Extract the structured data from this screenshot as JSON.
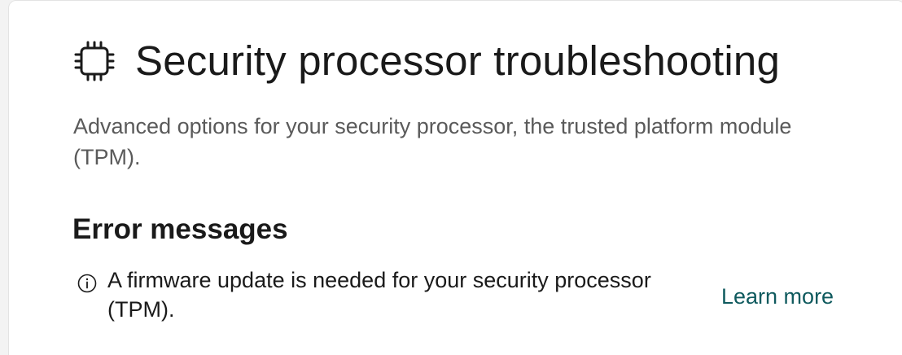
{
  "header": {
    "icon": "processor-chip-icon",
    "title": "Security processor troubleshooting"
  },
  "description": "Advanced options for your security processor, the trusted platform module (TPM).",
  "error_section": {
    "heading": "Error messages",
    "items": [
      {
        "icon": "info-icon",
        "message": "A firmware update is needed for your security processor (TPM).",
        "link_label": "Learn more"
      }
    ]
  },
  "colors": {
    "text_primary": "#1a1a1a",
    "text_secondary": "#5a5a5a",
    "link": "#0f5a5e",
    "card_background": "#ffffff"
  }
}
